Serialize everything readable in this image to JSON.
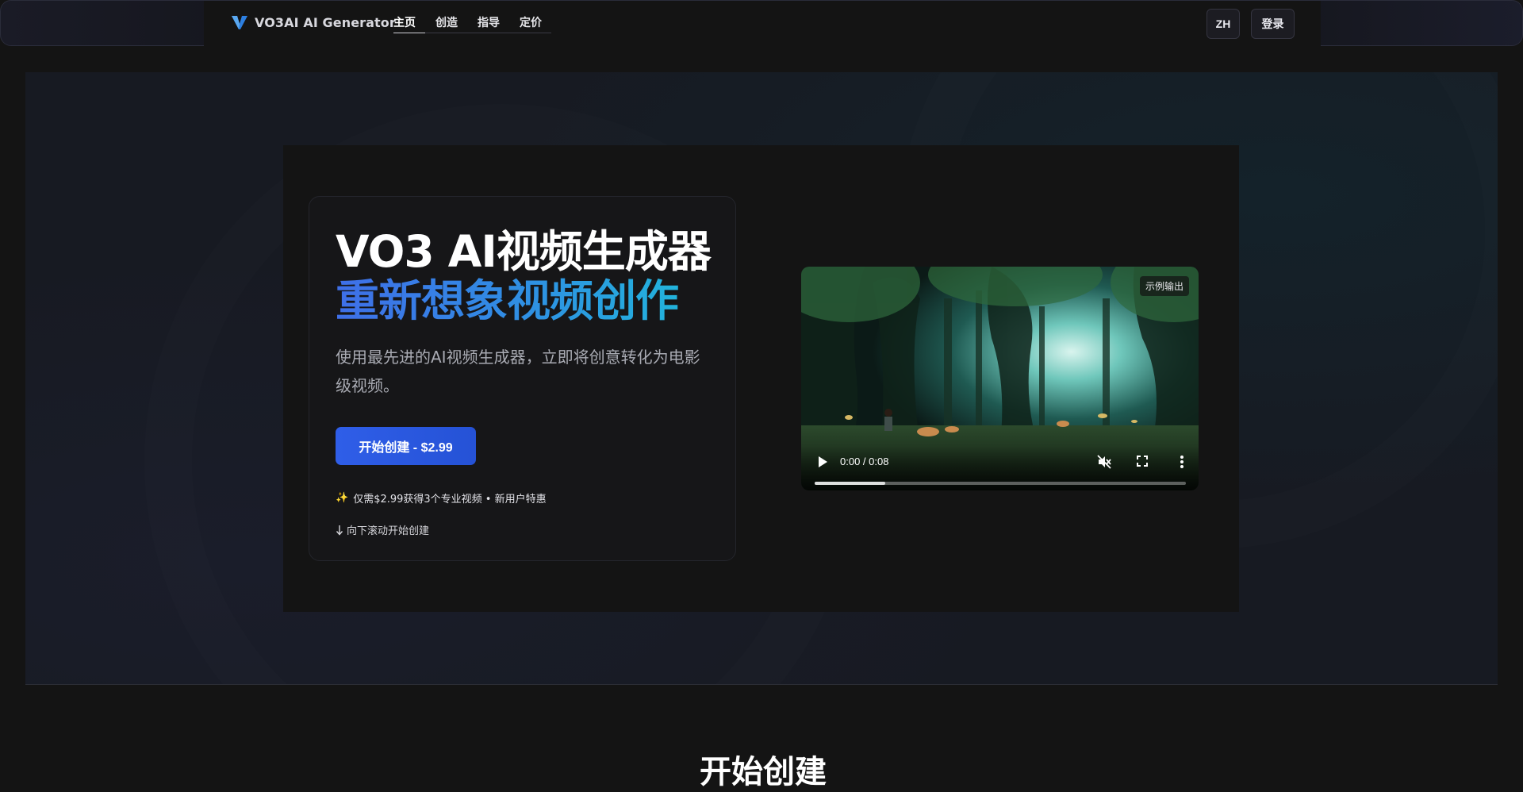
{
  "header": {
    "brand": "VO3AI AI Generator",
    "nav": [
      {
        "label": "主页",
        "active": true
      },
      {
        "label": "创造",
        "active": false
      },
      {
        "label": "指导",
        "active": false
      },
      {
        "label": "定价",
        "active": false
      }
    ],
    "lang_label": "ZH",
    "login_label": "登录"
  },
  "hero": {
    "title_line1": "VO3 AI视频生成器",
    "title_line2": "重新想象视频创作",
    "description": "使用最先进的AI视频生成器，立即将创意转化为电影级视频。",
    "cta_label": "开始创建 - $2.99",
    "promo_text": "仅需$2.99获得3个专业视频 • 新用户特惠",
    "scroll_hint": "向下滚动开始创建"
  },
  "video": {
    "badge": "示例输出",
    "time": "0:00 / 0:08",
    "progress": 0.19
  },
  "section": {
    "title": "开始创建"
  },
  "colors": {
    "accent": "#2f5ee8",
    "gradient_start": "#3f6fe8",
    "gradient_end": "#22b3dc",
    "background": "#141414"
  },
  "icons": [
    "vo3-logo-icon",
    "sparkle-icon",
    "arrow-down-icon",
    "play-icon",
    "mute-icon",
    "fullscreen-icon",
    "more-vertical-icon"
  ]
}
